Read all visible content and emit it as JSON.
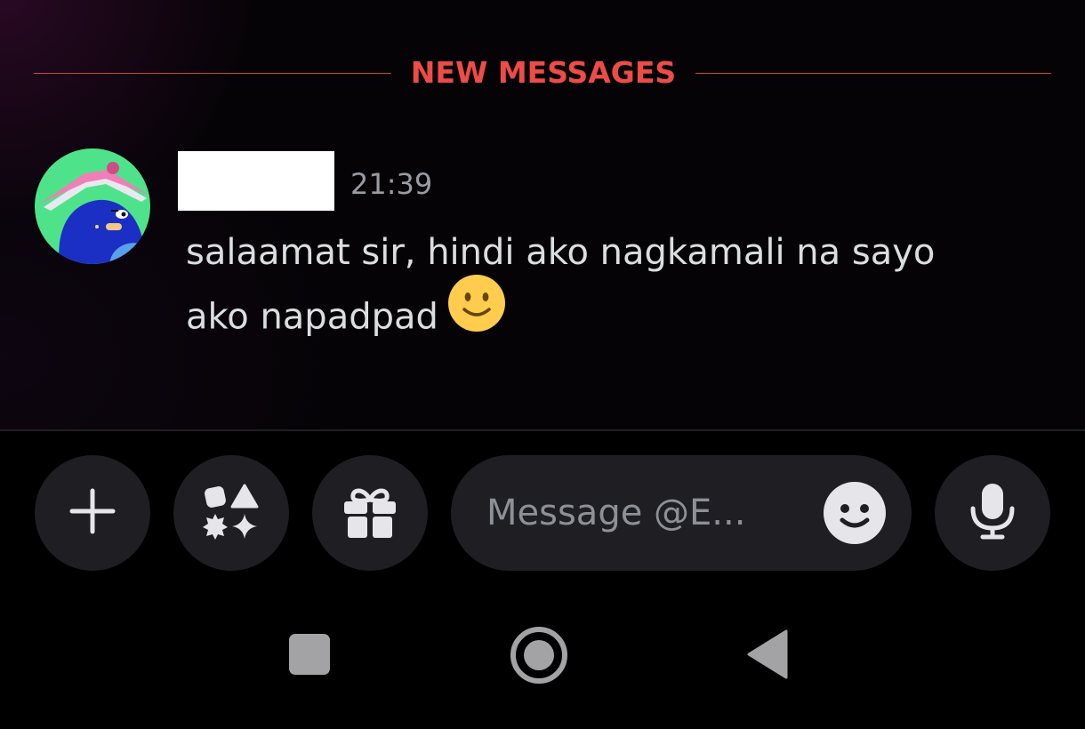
{
  "divider": {
    "label": "NEW MESSAGES"
  },
  "message": {
    "timestamp": "21:39",
    "line1": "salaamat sir, hindi ako nagkamali na sayo",
    "line2": "ako napadpad",
    "emoji": "slightly-smiling-face"
  },
  "composer": {
    "placeholder": "Message @E..."
  },
  "icons": {
    "plus": "plus-icon",
    "apps": "apps-icon",
    "gift": "gift-icon",
    "emoji": "emoji-icon",
    "mic": "microphone-icon",
    "recents": "recents-icon",
    "home": "home-icon",
    "back": "back-icon"
  },
  "colors": {
    "accent_new_messages": "#ef4b47",
    "text": "#dbdee1",
    "muted": "#9a9ca3",
    "button_bg": "#1f1f23"
  }
}
